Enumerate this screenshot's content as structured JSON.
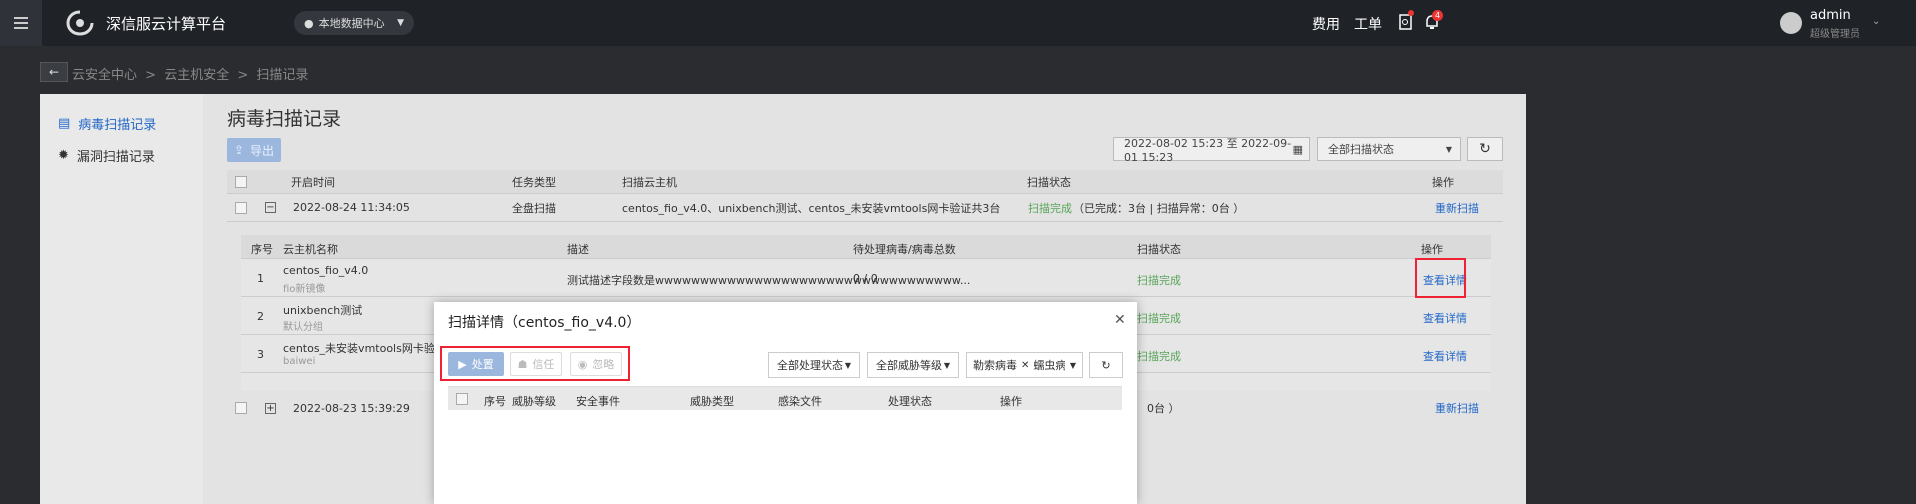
{
  "header": {
    "brand": "深信服云计算平台",
    "datacenter": "本地数据中心",
    "links": [
      "费用",
      "工单"
    ],
    "notification_count": "4",
    "user_name": "admin",
    "user_role": "超级管理员"
  },
  "breadcrumb": [
    "云安全中心",
    ">",
    "云主机安全",
    ">",
    "扫描记录"
  ],
  "sidebar": {
    "items": [
      {
        "label": "病毒扫描记录",
        "active": true
      },
      {
        "label": "漏洞扫描记录",
        "active": false
      }
    ]
  },
  "main": {
    "title": "病毒扫描记录",
    "export_label": "导出",
    "date_range": "2022-08-02 15:23 至 2022-09-01 15:23",
    "scan_status_filter": "全部扫描状态",
    "columns": [
      "开启时间",
      "任务类型",
      "扫描云主机",
      "扫描状态",
      "操作"
    ],
    "rows": [
      {
        "time": "2022-08-24 11:34:05",
        "type": "全盘扫描",
        "hosts": "centos_fio_v4.0、unixbench测试、centos_未安装vmtools网卡验证共3台",
        "status": "扫描完成",
        "status_detail": "（已完成：3台 | 扫描异常：0台 ）",
        "action": "重新扫描"
      },
      {
        "time": "2022-08-23 15:39:29",
        "status_detail": "0台 ）",
        "action": "重新扫描"
      }
    ]
  },
  "sub_table": {
    "columns": [
      "序号",
      "云主机名称",
      "描述",
      "待处理病毒/病毒总数",
      "扫描状态",
      "操作"
    ],
    "rows": [
      {
        "no": "1",
        "name": "centos_fio_v4.0",
        "sub": "fio新镜像",
        "desc": "测试描述字段数是wwwwwwwwwwwwwwwwwwwwwwwwwwwwwwwwww...",
        "count": "0 / 0",
        "status": "扫描完成",
        "action": "查看详情"
      },
      {
        "no": "2",
        "name": "unixbench测试",
        "sub": "默认分组",
        "desc": "",
        "count": "",
        "status": "扫描完成",
        "action": "查看详情"
      },
      {
        "no": "3",
        "name": "centos_未安装vmtools网卡验证",
        "sub": "baiwei",
        "desc": "",
        "count": "",
        "status": "扫描完成",
        "action": "查看详情"
      }
    ]
  },
  "modal": {
    "title": "扫描详情（centos_fio_v4.0）",
    "buttons": [
      "处置",
      "信任",
      "忽略"
    ],
    "filters": {
      "process_status": "全部处理状态",
      "threat_level": "全部威胁等级",
      "virus_tag": "勒索病毒",
      "virus_tag2": "蠕虫病毒"
    },
    "columns": [
      "序号",
      "威胁等级",
      "安全事件",
      "威胁类型",
      "感染文件",
      "处理状态",
      "操作"
    ]
  }
}
